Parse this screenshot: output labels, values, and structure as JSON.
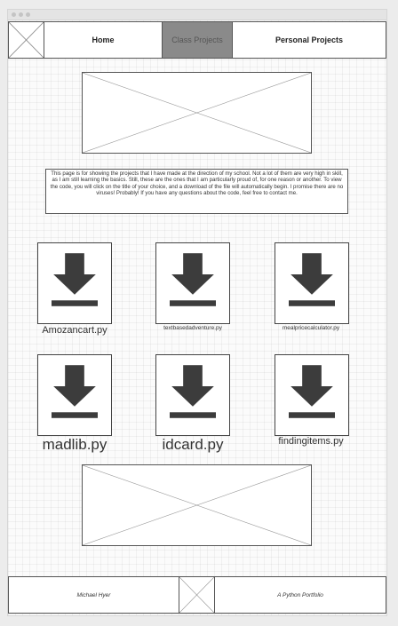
{
  "nav": {
    "home_label": "Home",
    "class_projects_label": "Class Projects",
    "personal_projects_label": "Personal Projects"
  },
  "intro": {
    "text": "This page is for showing the projects that I have made at the direction of my school. Not a lot of them are very high in skill, as I am still learning the basics. Still, these are the ones that I am particularly proud of, for one reason or another. To view the code, you will click on the title of your choice, and a download of the file will automatically begin. I promise there are no viruses! Probably! If you have any questions about the code, feel free to contact me."
  },
  "projects": [
    {
      "label": "Amozancart.py",
      "icon": "download-icon"
    },
    {
      "label": "textbasedadventure.py",
      "icon": "download-icon"
    },
    {
      "label": "mealpricecalculator.py",
      "icon": "download-icon"
    },
    {
      "label": "madlib.py",
      "icon": "download-icon"
    },
    {
      "label": "idcard.py",
      "icon": "download-icon"
    },
    {
      "label": "findingitems.py",
      "icon": "download-icon"
    }
  ],
  "footer": {
    "author": "Michael Hyer",
    "tagline": "A Python Portfolio"
  },
  "colors": {
    "active_nav": "#8a8a8a",
    "icon": "#3c3c3c"
  }
}
